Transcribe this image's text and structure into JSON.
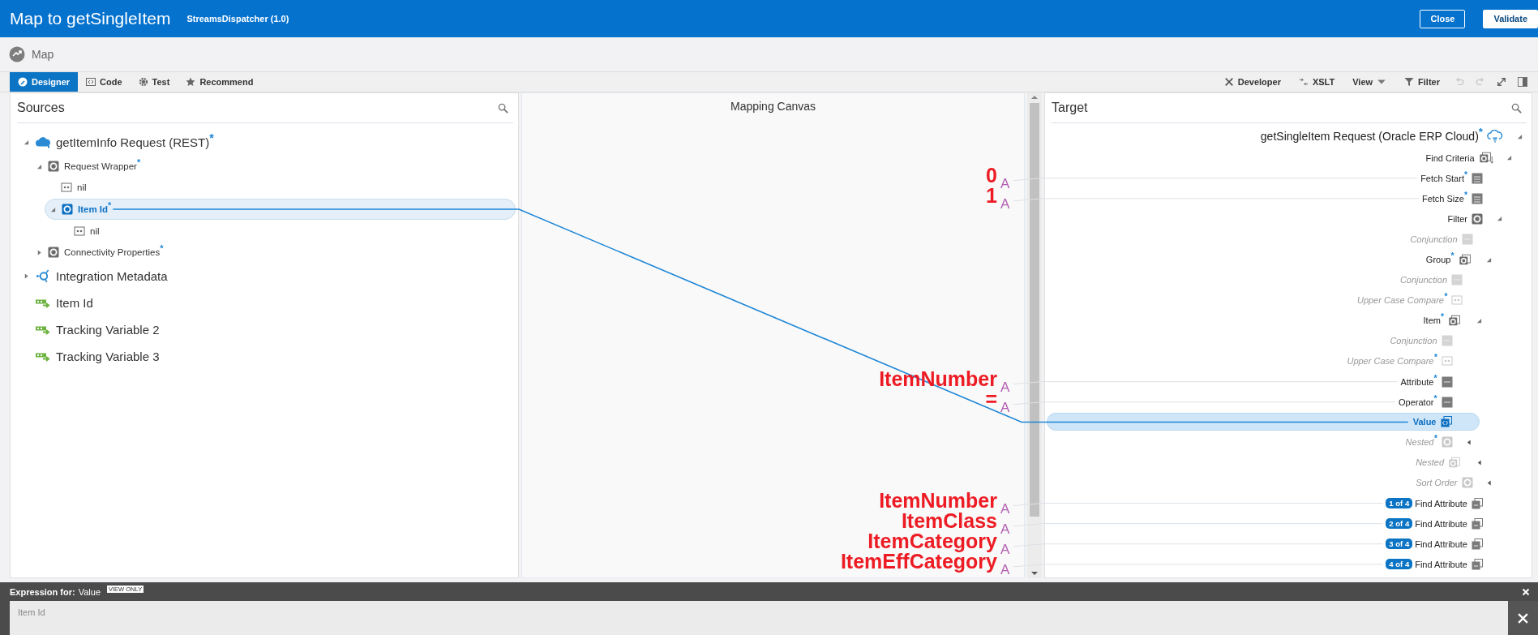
{
  "header": {
    "title": "Map to getSingleItem",
    "subtitle": "StreamsDispatcher (1.0)",
    "buttons": [
      {
        "label": "Close",
        "kind": "outline"
      },
      {
        "label": "Validate",
        "kind": "solid"
      }
    ]
  },
  "breadcrumb": {
    "label": "Map"
  },
  "toolbar": {
    "tabs": [
      {
        "label": "Designer",
        "kind": "designer",
        "selected": true
      },
      {
        "label": "Code",
        "kind": "code",
        "selected": false
      },
      {
        "label": "Test",
        "kind": "test",
        "selected": false
      },
      {
        "label": "Recommend",
        "kind": "recommend",
        "selected": false
      }
    ],
    "tools": [
      {
        "label": "Developer",
        "kind": "developer"
      },
      {
        "label": "XSLT",
        "kind": "xslt"
      },
      {
        "label": "View",
        "kind": "menu"
      },
      {
        "label": "Filter",
        "kind": "filter"
      }
    ],
    "icon_buttons": [
      {
        "kind": "undo",
        "disabled": true
      },
      {
        "kind": "redo",
        "disabled": true
      },
      {
        "kind": "fit",
        "disabled": false
      },
      {
        "kind": "panel",
        "disabled": false
      }
    ]
  },
  "sources": {
    "title": "Sources",
    "tree": [
      {
        "label": "getItemInfo Request (REST)$^{*}$",
        "kind": "cloud",
        "expanded": true,
        "selected": false,
        "children": [
          {
            "label": "Request Wrapper$^{*}$",
            "kind": "element",
            "expanded": true,
            "selected": false,
            "children": [
              {
                "label": "nil",
                "kind": "field",
                "selected": false
              },
              {
                "label": "Item Id$^{*}$",
                "kind": "element",
                "expanded": true,
                "selected": true,
                "children": [
                  {
                    "label": "nil",
                    "kind": "field",
                    "selected": false
                  }
                ]
              }
            ]
          },
          {
            "label": "Connectivity Properties$^{*}$",
            "kind": "element",
            "expanded": false,
            "selected": false
          }
        ]
      },
      {
        "label": "Integration Metadata",
        "kind": "metadata",
        "expanded": false,
        "selected": false
      },
      {
        "label": "Item Id",
        "kind": "variable",
        "selected": false
      },
      {
        "label": "Tracking Variable 2",
        "kind": "variable",
        "selected": false
      },
      {
        "label": "Tracking Variable 3",
        "kind": "variable",
        "selected": false
      }
    ]
  },
  "canvas": {
    "title": "Mapping Canvas"
  },
  "target": {
    "title": "Target",
    "tree": [
      {
        "label": "getSingleItem Request (Oracle ERP Cloud)$^{*}$",
        "kind": "cloud-outline",
        "expanded": true,
        "optional": false,
        "selected": false,
        "children": [
          {
            "label": "Find Criteria",
            "kind": "criteria",
            "expanded": true,
            "optional": false,
            "selected": false,
            "children": [
              {
                "label": "Fetch Start$^{*}$",
                "kind": "number",
                "optional": false,
                "selected": false,
                "constant": {
                  "marker": "A",
                  "note": "0"
                }
              },
              {
                "label": "Fetch Size$^{*}$",
                "kind": "number",
                "optional": false,
                "selected": false,
                "constant": {
                  "marker": "A",
                  "note": "1"
                }
              },
              {
                "label": "Filter",
                "kind": "element",
                "expanded": true,
                "optional": false,
                "selected": false,
                "children": [
                  {
                    "label": "Conjunction",
                    "kind": "string",
                    "optional": true,
                    "selected": false
                  },
                  {
                    "label": "Group$^{*}$",
                    "kind": "group",
                    "expanded": true,
                    "optional": false,
                    "selected": false,
                    "children": [
                      {
                        "label": "Conjunction",
                        "kind": "string",
                        "optional": true,
                        "selected": false
                      },
                      {
                        "label": "Upper Case Compare$^{*}$",
                        "kind": "field",
                        "optional": true,
                        "selected": false
                      },
                      {
                        "label": "Item$^{*}$",
                        "kind": "group",
                        "expanded": true,
                        "optional": false,
                        "selected": false,
                        "children": [
                          {
                            "label": "Conjunction",
                            "kind": "string",
                            "optional": true,
                            "selected": false
                          },
                          {
                            "label": "Upper Case Compare$^{*}$",
                            "kind": "field",
                            "optional": true,
                            "selected": false
                          },
                          {
                            "label": "Attribute$^{*}$",
                            "kind": "string",
                            "optional": false,
                            "selected": false,
                            "constant": {
                              "marker": "A",
                              "note": "ItemNumber"
                            }
                          },
                          {
                            "label": "Operator$^{*}$",
                            "kind": "string",
                            "optional": false,
                            "selected": false,
                            "constant": {
                              "marker": "A",
                              "note": "="
                            }
                          },
                          {
                            "label": "Value",
                            "kind": "value",
                            "optional": false,
                            "selected": true
                          },
                          {
                            "label": "Nested$^{*}$",
                            "kind": "element",
                            "expanded": false,
                            "optional": true,
                            "selected": false
                          }
                        ]
                      },
                      {
                        "label": "Nested",
                        "kind": "group",
                        "expanded": false,
                        "optional": true,
                        "selected": false
                      }
                    ]
                  },
                  {
                    "label": "Sort Order",
                    "kind": "element",
                    "expanded": false,
                    "optional": true,
                    "selected": false
                  }
                ]
              },
              {
                "label": "Find Attribute",
                "badge": "1 of 4",
                "kind": "array",
                "optional": false,
                "selected": false,
                "constant": {
                  "marker": "A",
                  "note": "ItemNumber"
                }
              },
              {
                "label": "Find Attribute",
                "badge": "2 of 4",
                "kind": "array",
                "optional": false,
                "selected": false,
                "constant": {
                  "marker": "A",
                  "note": "ItemClass"
                }
              },
              {
                "label": "Find Attribute",
                "badge": "3 of 4",
                "kind": "array",
                "optional": false,
                "selected": false,
                "constant": {
                  "marker": "A",
                  "note": "ItemCategory"
                }
              },
              {
                "label": "Find Attribute",
                "badge": "4 of 4",
                "kind": "array",
                "optional": false,
                "selected": false,
                "constant": {
                  "marker": "A",
                  "note": "ItemEffCategory"
                }
              }
            ]
          }
        ]
      }
    ]
  },
  "expression": {
    "label": "Expression for:",
    "field": "Value",
    "badge": "VIEW ONLY",
    "value": "Item Id"
  }
}
